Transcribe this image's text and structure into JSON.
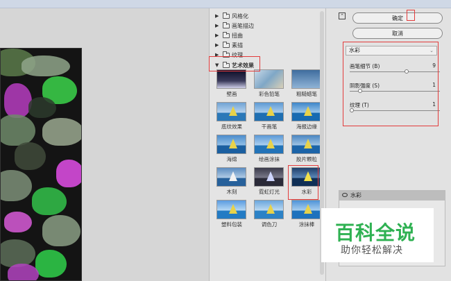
{
  "gallery": {
    "categories": [
      {
        "label": "风格化",
        "expanded": false
      },
      {
        "label": "画笔描边",
        "expanded": false
      },
      {
        "label": "扭曲",
        "expanded": false
      },
      {
        "label": "素描",
        "expanded": false
      },
      {
        "label": "纹理",
        "expanded": false
      },
      {
        "label": "艺术效果",
        "expanded": true
      }
    ],
    "filters": [
      "壁画",
      "彩色铅笔",
      "粗糙蜡笔",
      "底纹效果",
      "干画笔",
      "海报边缘",
      "海绵",
      "绘画涂抹",
      "胶片颗粒",
      "木刻",
      "霓虹灯光",
      "水彩",
      "塑料包装",
      "调色刀",
      "涂抹棒"
    ],
    "selected_filter": "水彩"
  },
  "actions": {
    "ok_label": "确定",
    "cancel_label": "取消"
  },
  "settings": {
    "filter_select": "水彩",
    "params": [
      {
        "label": "画笔细节 (B)",
        "value": "9",
        "level": 0.64
      },
      {
        "label": "阴影强度 (S)",
        "value": "1",
        "level": 0.1
      },
      {
        "label": "纹理 (T)",
        "value": "1",
        "level": 0.0
      }
    ]
  },
  "layers": {
    "active_effect": "水彩"
  },
  "watermark": {
    "title": "百科全说",
    "subtitle": "助你轻松解决"
  },
  "colors": {
    "highlight": "#e23b3b",
    "watermark_green": "#2fb152"
  },
  "icons": {
    "expand": "chevron-right-icon",
    "collapse": "chevron-down-icon",
    "folder": "folder-icon",
    "eye": "eye-icon",
    "panel_toggle": "panel-toggle-icon"
  }
}
